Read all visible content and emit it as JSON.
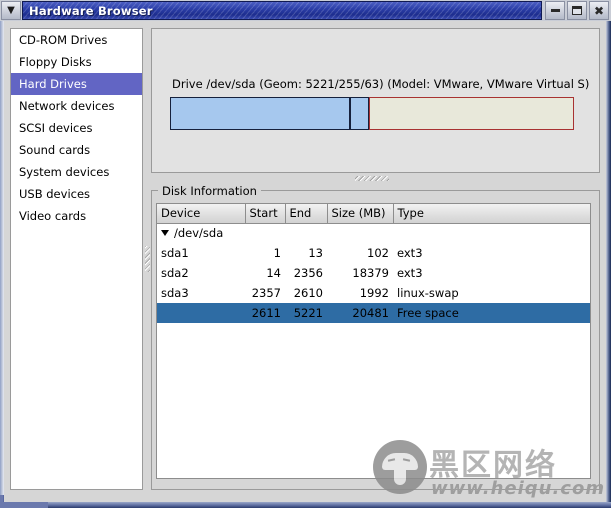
{
  "window": {
    "title": "Hardware Browser",
    "menu_icon": "chevron-down-icon",
    "minimize_label": "",
    "maximize_label": "",
    "close_label": "✖"
  },
  "sidebar": {
    "items": [
      {
        "label": "CD-ROM Drives",
        "selected": false
      },
      {
        "label": "Floppy Disks",
        "selected": false
      },
      {
        "label": "Hard Drives",
        "selected": true
      },
      {
        "label": "Network devices",
        "selected": false
      },
      {
        "label": "SCSI devices",
        "selected": false
      },
      {
        "label": "Sound cards",
        "selected": false
      },
      {
        "label": "System devices",
        "selected": false
      },
      {
        "label": "USB devices",
        "selected": false
      },
      {
        "label": "Video cards",
        "selected": false
      }
    ]
  },
  "drive_panel": {
    "label": "Drive /dev/sda (Geom: 5221/255/63) (Model: VMware, VMware Virtual S)",
    "segments": [
      {
        "name": "sda1+sda2",
        "kind": "used",
        "width_pct": 44.6
      },
      {
        "name": "sda3",
        "kind": "used",
        "width_pct": 4.7
      },
      {
        "name": "free-space",
        "kind": "free",
        "width_pct": 50.7
      }
    ]
  },
  "disk_information": {
    "legend": "Disk Information",
    "columns": [
      "Device",
      "Start",
      "End",
      "Size (MB)",
      "Type"
    ],
    "rows": [
      {
        "device": "/dev/sda",
        "start": "",
        "end": "",
        "size": "",
        "type": "",
        "root": true,
        "selected": false
      },
      {
        "device": "sda1",
        "start": "1",
        "end": "13",
        "size": "102",
        "type": "ext3",
        "root": false,
        "selected": false
      },
      {
        "device": "sda2",
        "start": "14",
        "end": "2356",
        "size": "18379",
        "type": "ext3",
        "root": false,
        "selected": false
      },
      {
        "device": "sda3",
        "start": "2357",
        "end": "2610",
        "size": "1992",
        "type": "linux-swap",
        "root": false,
        "selected": false
      },
      {
        "device": "",
        "start": "2611",
        "end": "5221",
        "size": "20481",
        "type": "Free space",
        "root": false,
        "selected": true
      }
    ]
  },
  "watermark": {
    "chinese": "黑区网络",
    "url": "www.heiqu.com",
    "logo_icon": "mushroom-icon"
  },
  "colors": {
    "titlebar_blue": "#2b3ea8",
    "sidebar_selection": "#6265c4",
    "row_selection": "#2e6ca4",
    "partition_used": "#a6c8ee",
    "partition_free": "#e8e8da",
    "partition_free_border": "#a83232"
  }
}
